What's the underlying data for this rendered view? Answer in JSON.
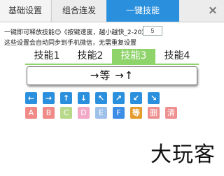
{
  "top_tabs": [
    {
      "label": "基础设置"
    },
    {
      "label": "组合连发"
    },
    {
      "label": "一键技能"
    }
  ],
  "close_glyph": "×",
  "settings": {
    "line1": "一键即可释放技能😊《按键速度，越小越快_2-20》",
    "speed_value": "5",
    "line2": "这些设置会自动同步到手机微信，无需重复设置"
  },
  "skill_tabs": [
    {
      "label": "技能1"
    },
    {
      "label": "技能2"
    },
    {
      "label": "技能3"
    },
    {
      "label": "技能4"
    }
  ],
  "combo_display": "→等 →↑",
  "arrow_keys": [
    {
      "glyph": "←",
      "icon": "arrow-left-icon"
    },
    {
      "glyph": "→",
      "icon": "arrow-right-icon"
    },
    {
      "glyph": "↑",
      "icon": "arrow-up-icon"
    },
    {
      "glyph": "↓",
      "icon": "arrow-down-icon"
    },
    {
      "glyph": "↖",
      "icon": "arrow-up-left-icon"
    },
    {
      "glyph": "↗",
      "icon": "arrow-up-right-icon"
    },
    {
      "glyph": "↙",
      "icon": "arrow-down-left-icon"
    },
    {
      "glyph": "↘",
      "icon": "arrow-down-right-icon"
    }
  ],
  "letter_keys": [
    {
      "label": "A"
    },
    {
      "label": "B"
    },
    {
      "label": "C"
    },
    {
      "label": "D"
    },
    {
      "label": "E"
    },
    {
      "label": "F"
    },
    {
      "label": "等"
    },
    {
      "label": "删"
    },
    {
      "label": "清"
    }
  ],
  "watermark": "大玩客",
  "colors": {
    "accent_blue": "#2a8fdc",
    "skill_green": "#8fd36b"
  }
}
